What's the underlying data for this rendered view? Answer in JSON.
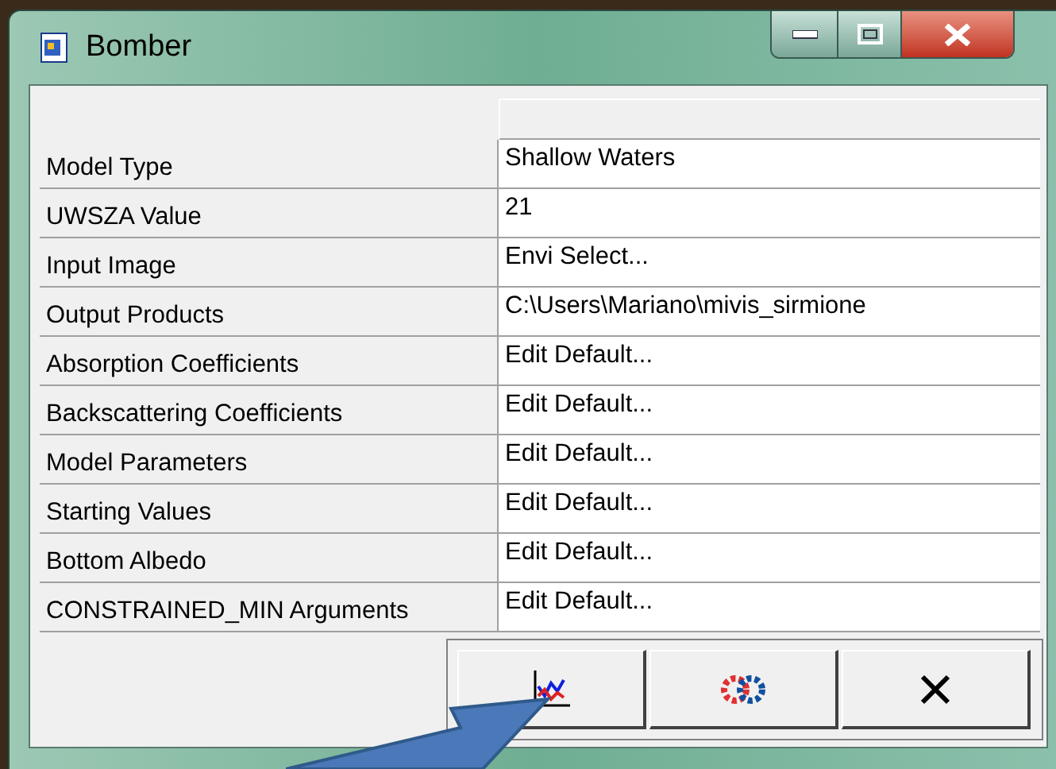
{
  "window": {
    "title": "Bomber"
  },
  "properties": [
    {
      "label": "Model Type",
      "value": "Shallow Waters"
    },
    {
      "label": "UWSZA Value",
      "value": "21"
    },
    {
      "label": "Input Image",
      "value": "Envi Select..."
    },
    {
      "label": "Output Products",
      "value": "C:\\Users\\Mariano\\mivis_sirmione"
    },
    {
      "label": "Absorption Coefficients",
      "value": "Edit Default..."
    },
    {
      "label": "Backscattering Coefficients",
      "value": "Edit Default..."
    },
    {
      "label": "Model Parameters",
      "value": "Edit Default..."
    },
    {
      "label": "Starting Values",
      "value": "Edit Default..."
    },
    {
      "label": "Bottom Albedo",
      "value": "Edit Default..."
    },
    {
      "label": "CONSTRAINED_MIN Arguments",
      "value": "Edit Default..."
    }
  ],
  "buttons": [
    {
      "kind": "plot"
    },
    {
      "kind": "gears"
    },
    {
      "kind": "close"
    }
  ]
}
